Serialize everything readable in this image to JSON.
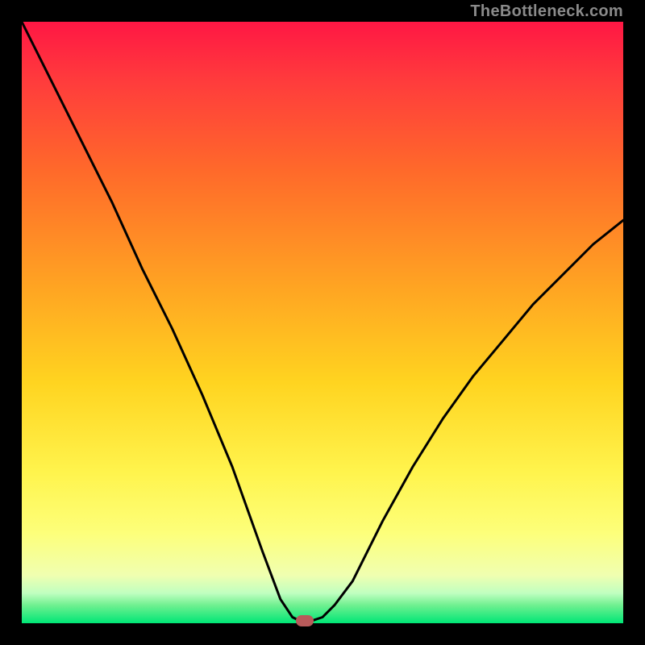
{
  "watermark": "TheBottleneck.com",
  "chart_data": {
    "type": "line",
    "title": "",
    "xlabel": "",
    "ylabel": "",
    "xlim": [
      0,
      100
    ],
    "ylim": [
      0,
      100
    ],
    "series": [
      {
        "name": "bottleneck-curve",
        "x": [
          0,
          5,
          10,
          15,
          20,
          25,
          30,
          35,
          40,
          43,
          45,
          47,
          50,
          52,
          55,
          60,
          65,
          70,
          75,
          80,
          85,
          90,
          95,
          100
        ],
        "values": [
          100,
          90,
          80,
          70,
          59,
          49,
          38,
          26,
          12,
          4,
          1,
          0,
          1,
          3,
          7,
          17,
          26,
          34,
          41,
          47,
          53,
          58,
          63,
          67
        ]
      }
    ],
    "marker": {
      "x": 47,
      "y": 0,
      "color": "#b85a5a"
    },
    "background_gradient": [
      "#ff1744",
      "#ffd420",
      "#00e676"
    ]
  }
}
